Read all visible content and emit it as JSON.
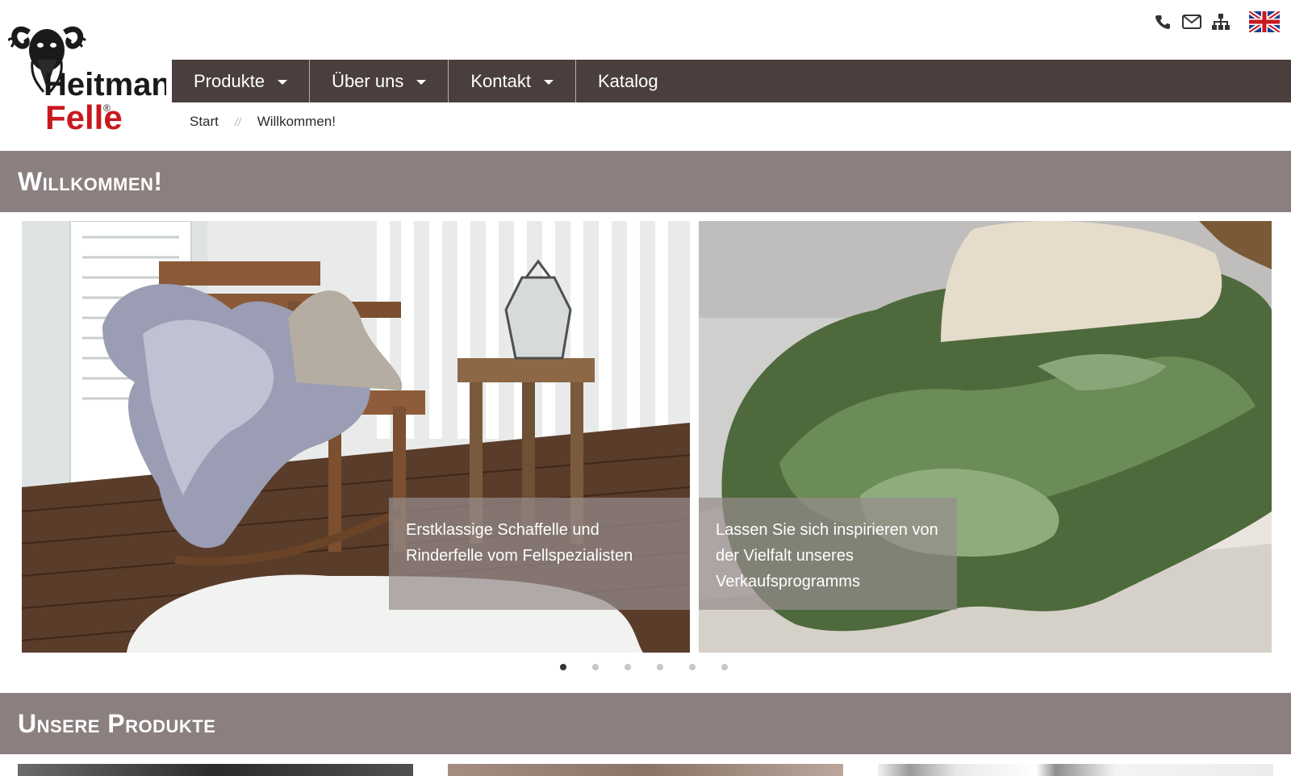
{
  "header": {
    "logo": {
      "brand_line1": "Heitmann",
      "brand_line2": "Felle",
      "registered": "®"
    },
    "top_icons": [
      "phone-icon",
      "mail-icon",
      "sitemap-icon",
      "uk-flag-icon"
    ]
  },
  "nav": {
    "items": [
      {
        "label": "Produkte",
        "has_dropdown": true
      },
      {
        "label": "Über uns",
        "has_dropdown": true
      },
      {
        "label": "Kontakt",
        "has_dropdown": true
      },
      {
        "label": "Katalog",
        "has_dropdown": false
      }
    ]
  },
  "breadcrumb": {
    "items": [
      "Start",
      "Willkommen!"
    ],
    "separator": "//"
  },
  "welcome": {
    "title": "Willkommen!"
  },
  "slider": {
    "slides": [
      {
        "caption": "Erstklassige Schaffelle und Rinderfelle vom Fellspezialisten"
      },
      {
        "caption": "Lassen Sie sich inspirieren von der Vielfalt unseres Verkaufsprogramms"
      }
    ],
    "dot_count": 6,
    "active_dot": 1
  },
  "products": {
    "title": "Unsere Produkte"
  },
  "colors": {
    "nav_bg": "#4a3f3c",
    "section_bar": "#8b7f7f",
    "logo_red": "#c8191f",
    "text_dark": "#222222"
  }
}
